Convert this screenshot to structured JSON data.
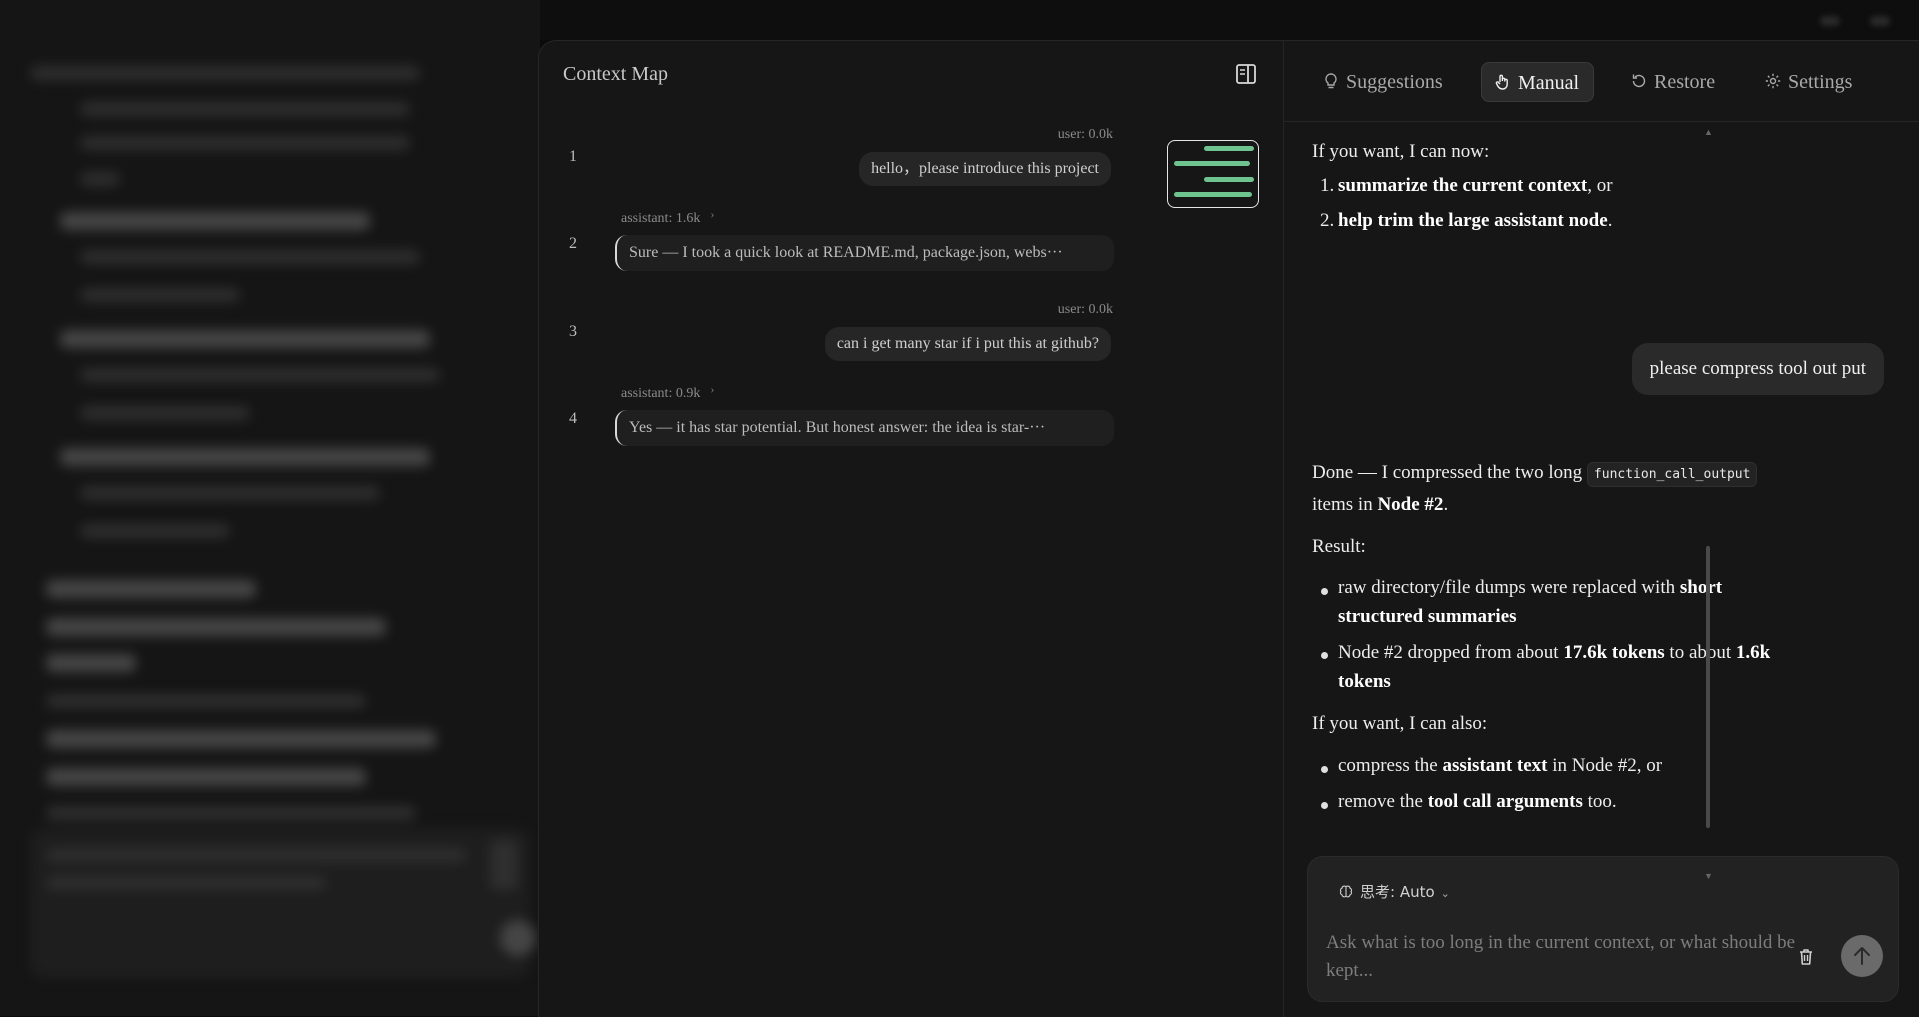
{
  "context_map": {
    "title": "Context Map",
    "nodes": [
      {
        "index": "1",
        "meta": "user: 0.0k",
        "text": "hello，please introduce this project"
      },
      {
        "index": "2",
        "meta": "assistant: 1.6k",
        "text": "Sure — I took a quick look at README.md, package.json, webs···"
      },
      {
        "index": "3",
        "meta": "user: 0.0k",
        "text": "can i get many star if i put this at github?"
      },
      {
        "index": "4",
        "meta": "assistant: 0.9k",
        "text": "Yes — it has star potential. But honest answer: the idea is star-···"
      }
    ]
  },
  "tabs": {
    "suggestions": "Suggestions",
    "manual": "Manual",
    "restore": "Restore",
    "settings": "Settings"
  },
  "chat": {
    "intro": "If you want, I can now:",
    "option1_bold": "summarize the current context",
    "option1_rest": ", or",
    "option2_bold": "help trim the large assistant node",
    "option2_rest": ".",
    "user_message": "please compress tool out put",
    "done_pre": "Done — I compressed the two long",
    "done_code": "function_call_output",
    "done_line2_pre": "items in",
    "done_line2_bold": "Node #2",
    "done_line2_post": ".",
    "result_label": "Result:",
    "r1_pre": "raw directory/file dumps were replaced with",
    "r1_bold1": "short",
    "r1_bold2": "structured summaries",
    "r2_pre": "Node #2 dropped from about",
    "r2_bold1": "17.6k tokens",
    "r2_mid": "to about",
    "r2_bold2": "1.6k",
    "r2_bold3": "tokens",
    "also_label": "If you want, I can also:",
    "a1_pre": "compress the",
    "a1_bold": "assistant text",
    "a1_post": "in Node #2, or",
    "a2_pre": "remove the",
    "a2_bold": "tool call arguments",
    "a2_post": "too."
  },
  "composer": {
    "think_label": "思考:",
    "think_value": "Auto",
    "placeholder": "Ask what is too long in the current context, or what should be kept..."
  },
  "colors": {
    "accent_green": "#6ec38e",
    "panel_bg": "#161616",
    "bubble_bg": "#262626"
  }
}
